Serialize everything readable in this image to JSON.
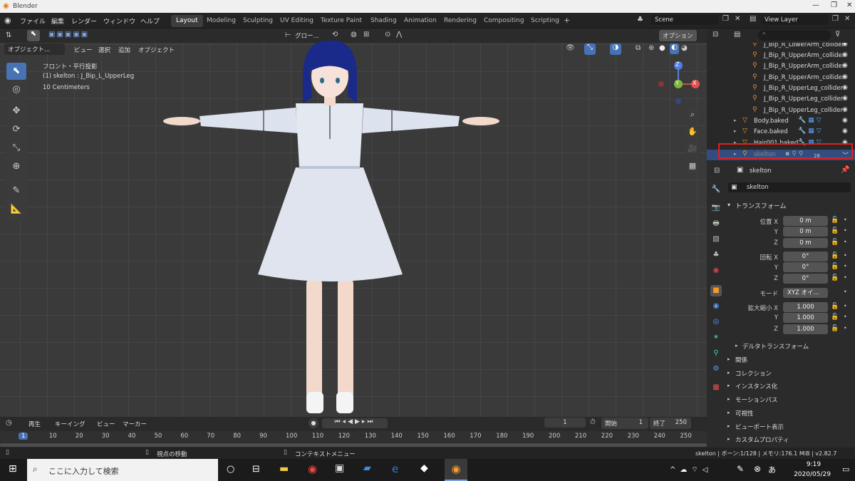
{
  "titlebar": {
    "title": "Blender"
  },
  "menu": [
    "ファイル",
    "編集",
    "レンダー",
    "ウィンドウ",
    "ヘルプ"
  ],
  "workspaces": [
    "Layout",
    "Modeling",
    "Sculpting",
    "UV Editing",
    "Texture Paint",
    "Shading",
    "Animation",
    "Rendering",
    "Compositing",
    "Scripting"
  ],
  "workspace_add": "+",
  "scene": {
    "label": "Scene",
    "view_layer": "View Layer"
  },
  "viewport": {
    "header": {
      "transform_orient": "グロー...",
      "options": "オプション"
    },
    "header2": {
      "mode": "オブジェクト...",
      "items": [
        "ビュー",
        "選択",
        "追加",
        "オブジェクト"
      ]
    },
    "overlay": {
      "line1": "フロント・平行投影",
      "line2": "(1) skelton : J_Bip_L_UpperLeg",
      "line3": "10 Centimeters"
    },
    "gizmo": {
      "z": "Z",
      "y": "Y",
      "x": "X"
    }
  },
  "timeline": {
    "menu": [
      "再生",
      "キーイング",
      "ビュー",
      "マーカー"
    ],
    "current_frame": "1",
    "start_label": "開始",
    "start": "1",
    "end_label": "終了",
    "end": "250",
    "ticks": [
      "1",
      "10",
      "20",
      "30",
      "40",
      "50",
      "60",
      "70",
      "80",
      "90",
      "100",
      "110",
      "120",
      "130",
      "140",
      "150",
      "160",
      "170",
      "180",
      "190",
      "200",
      "210",
      "220",
      "230",
      "240",
      "250"
    ]
  },
  "statusbar": {
    "left": "視点の移動",
    "mid": "コンテキストメニュー",
    "right": "skelton | ボーン:1/128 | メモリ:176.1 MiB | v2.82.7"
  },
  "outliner": {
    "rows": [
      {
        "label": "J_Bip_R_LowerArm_collider"
      },
      {
        "label": "J_Bip_R_UpperArm_collider"
      },
      {
        "label": "J_Bip_R_UpperArm_collider"
      },
      {
        "label": "J_Bip_R_UpperArm_collider"
      },
      {
        "label": "J_Bip_R_UpperLeg_collider"
      },
      {
        "label": "J_Bip_R_UpperLeg_collider"
      },
      {
        "label": "J_Bip_R_UpperLeg_collider"
      },
      {
        "label": "Body.baked"
      },
      {
        "label": "Face.baked"
      },
      {
        "label": "Hair001.baked"
      },
      {
        "label": "skelton",
        "badge": "28"
      }
    ]
  },
  "properties": {
    "object_name": "skelton",
    "object_field": "skelton",
    "transform_header": "トランスフォーム",
    "location_label": "位置 X",
    "rotation_label": "回転 X",
    "scale_label": "拡大縮小 X",
    "y": "Y",
    "z": "Z",
    "location": [
      "0 m",
      "0 m",
      "0 m"
    ],
    "rotation": [
      "0°",
      "0°",
      "0°"
    ],
    "mode_label": "モード",
    "mode_value": "XYZ オイ...",
    "scale": [
      "1.000",
      "1.000",
      "1.000"
    ],
    "delta": "デルタトランスフォーム",
    "sections": [
      "関係",
      "コレクション",
      "インスタンス化",
      "モーションパス",
      "可視性",
      "ビューポート表示",
      "カスタムプロパティ"
    ]
  },
  "taskbar": {
    "search_placeholder": "ここに入力して検索",
    "time": "9:19",
    "date": "2020/05/29"
  },
  "colors": {
    "accent": "#4772b3",
    "highlight_box": "#e02020"
  }
}
